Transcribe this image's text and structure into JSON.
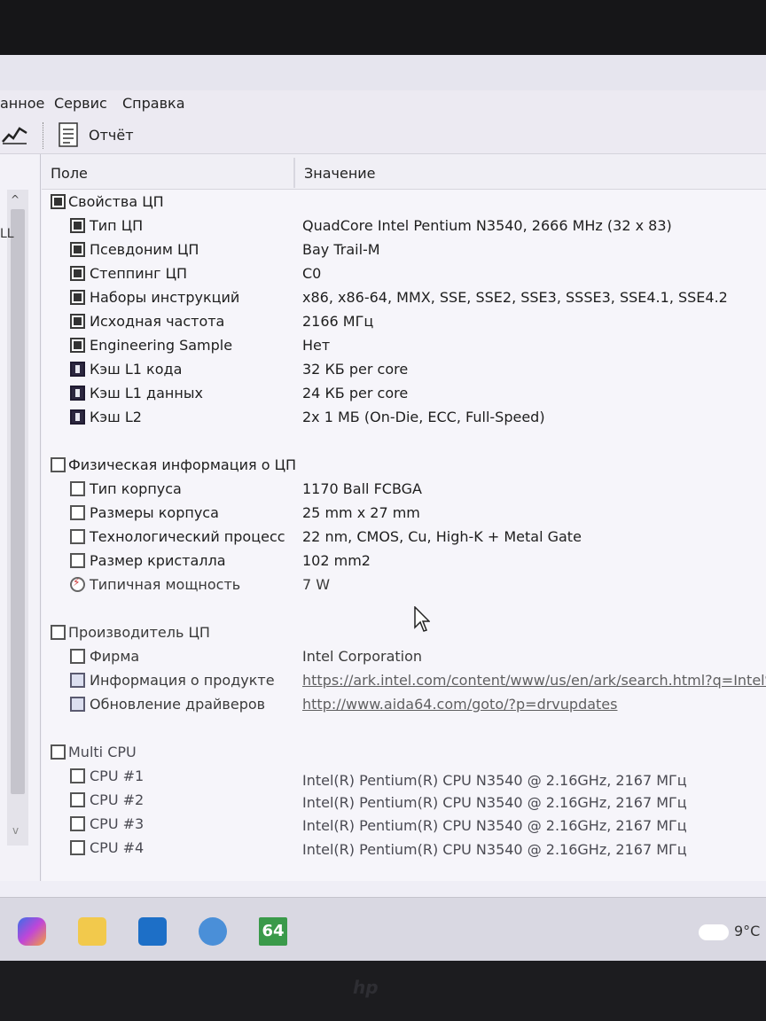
{
  "menu": {
    "items": [
      "анное",
      "Сервис",
      "Справка"
    ]
  },
  "toolbar": {
    "report_label": "Отчёт"
  },
  "leftpane": {
    "fragment": "LL"
  },
  "columns": {
    "field": "Поле",
    "value": "Значение"
  },
  "rows": [
    {
      "label": "Свойства ЦП",
      "value": ""
    },
    {
      "label": "Тип ЦП",
      "value": "QuadCore Intel Pentium N3540, 2666 MHz (32 x 83)"
    },
    {
      "label": "Псевдоним ЦП",
      "value": "Bay Trail-M"
    },
    {
      "label": "Степпинг ЦП",
      "value": "C0"
    },
    {
      "label": "Наборы инструкций",
      "value": "x86, x86-64, MMX, SSE, SSE2, SSE3, SSSE3, SSE4.1, SSE4.2"
    },
    {
      "label": "Исходная частота",
      "value": "2166 МГц"
    },
    {
      "label": "Engineering Sample",
      "value": "Нет"
    },
    {
      "label": "Кэш L1 кода",
      "value": "32 КБ per core"
    },
    {
      "label": "Кэш L1 данных",
      "value": "24 КБ per core"
    },
    {
      "label": "Кэш L2",
      "value": "2x 1 МБ  (On-Die, ECC, Full-Speed)"
    },
    {
      "label": "Физическая информация о ЦП",
      "value": ""
    },
    {
      "label": "Тип корпуса",
      "value": "1170 Ball FCBGA"
    },
    {
      "label": "Размеры корпуса",
      "value": "25 mm x 27 mm"
    },
    {
      "label": "Технологический процесс",
      "value": "22 nm, CMOS, Cu, High-K + Metal Gate"
    },
    {
      "label": "Размер кристалла",
      "value": "102 mm2"
    },
    {
      "label": "Типичная мощность",
      "value": "7 W"
    },
    {
      "label": "Производитель ЦП",
      "value": ""
    },
    {
      "label": "Фирма",
      "value": "Intel Corporation"
    },
    {
      "label": "Информация о продукте",
      "value": "https://ark.intel.com/content/www/us/en/ark/search.html?q=Intel%"
    },
    {
      "label": "Обновление драйверов",
      "value": "http://www.aida64.com/goto/?p=drvupdates"
    },
    {
      "label": "Multi CPU",
      "value": ""
    },
    {
      "label": "CPU #1",
      "value": "Intel(R) Pentium(R) CPU N3540 @ 2.16GHz, 2167 МГц"
    },
    {
      "label": "CPU #2",
      "value": "Intel(R) Pentium(R) CPU N3540 @ 2.16GHz, 2167 МГц"
    },
    {
      "label": "CPU #3",
      "value": "Intel(R) Pentium(R) CPU N3540 @ 2.16GHz, 2167 МГц"
    },
    {
      "label": "CPU #4",
      "value": "Intel(R) Pentium(R) CPU N3540 @ 2.16GHz, 2167 МГц"
    }
  ],
  "taskbar": {
    "apps": [
      "copilot-icon",
      "file-explorer-icon",
      "outlook-icon",
      "browser-icon",
      "aida64-icon"
    ],
    "aida_label": "64",
    "temperature": "9°C"
  },
  "colors": {
    "url": "#5a7bd1",
    "screen_bg": "#efeef6"
  }
}
